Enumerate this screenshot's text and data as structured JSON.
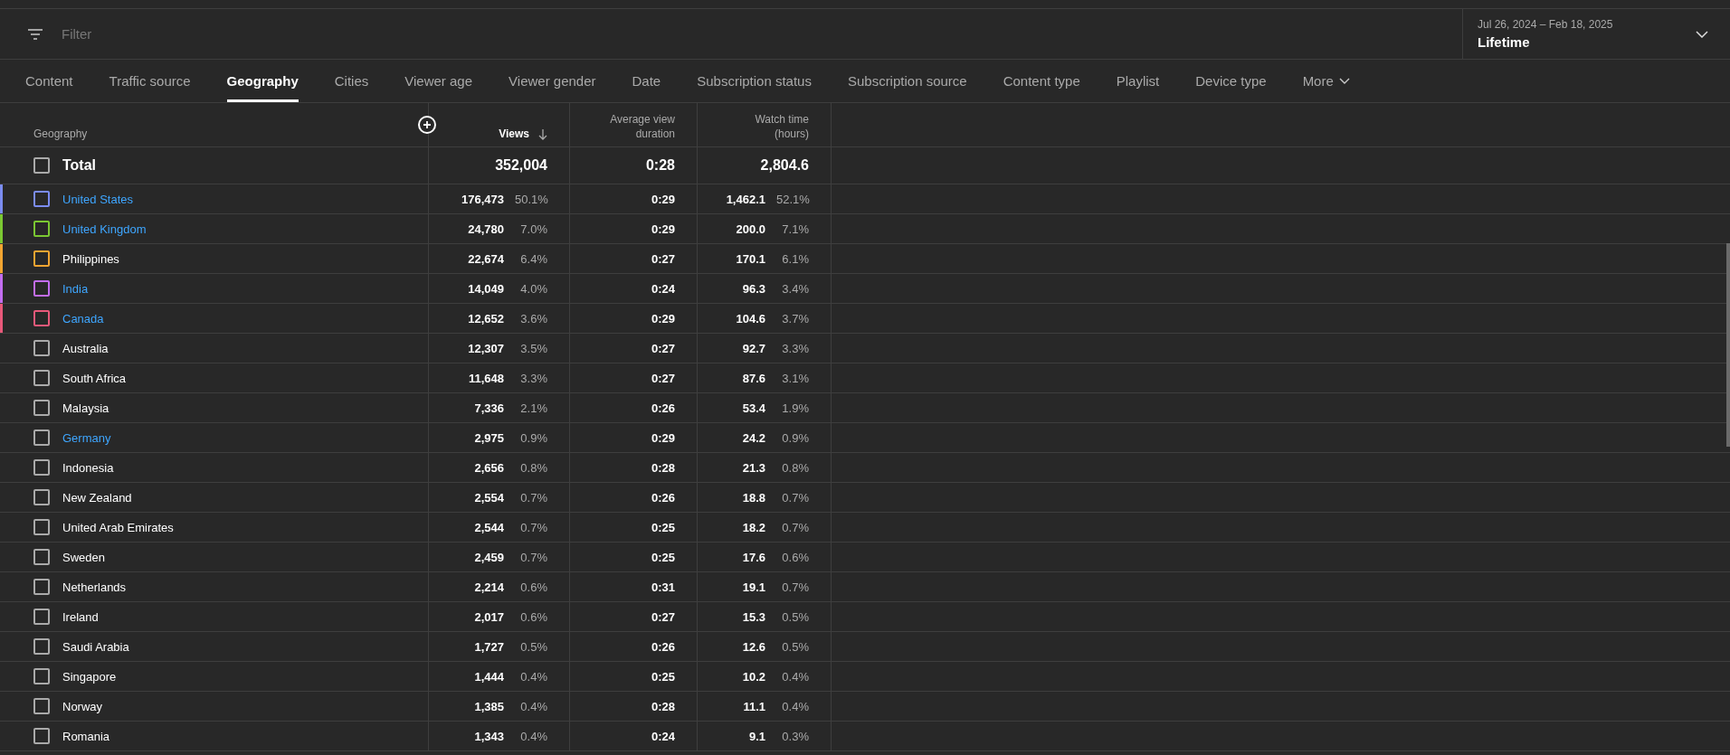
{
  "filter": {
    "placeholder": "Filter"
  },
  "date_range": {
    "range": "Jul 26, 2024 – Feb 18, 2025",
    "label": "Lifetime"
  },
  "tabs": [
    {
      "label": "Content",
      "selected": false
    },
    {
      "label": "Traffic source",
      "selected": false
    },
    {
      "label": "Geography",
      "selected": true
    },
    {
      "label": "Cities",
      "selected": false
    },
    {
      "label": "Viewer age",
      "selected": false
    },
    {
      "label": "Viewer gender",
      "selected": false
    },
    {
      "label": "Date",
      "selected": false
    },
    {
      "label": "Subscription status",
      "selected": false
    },
    {
      "label": "Subscription source",
      "selected": false
    },
    {
      "label": "Content type",
      "selected": false
    },
    {
      "label": "Playlist",
      "selected": false
    },
    {
      "label": "Device type",
      "selected": false
    },
    {
      "label": "More",
      "selected": false
    }
  ],
  "table": {
    "columns": [
      "Geography",
      "Views",
      "Average view duration",
      "Watch time (hours)"
    ],
    "total": {
      "label": "Total",
      "checked": false,
      "views": "352,004",
      "duration": "0:28",
      "watch_time": "2,804.6"
    },
    "rows": [
      {
        "name": "United States",
        "selected": true,
        "checked": false,
        "color": "#7b8cf0",
        "linked": true,
        "views": "176,473",
        "views_pct": "50.1%",
        "duration": "0:29",
        "watch_time": "1,462.1",
        "watch_pct": "52.1%"
      },
      {
        "name": "United Kingdom",
        "selected": true,
        "checked": false,
        "color": "#7bc832",
        "linked": true,
        "views": "24,780",
        "views_pct": "7.0%",
        "duration": "0:29",
        "watch_time": "200.0",
        "watch_pct": "7.1%"
      },
      {
        "name": "Philippines",
        "selected": true,
        "checked": false,
        "color": "#f2a531",
        "linked": false,
        "views": "22,674",
        "views_pct": "6.4%",
        "duration": "0:27",
        "watch_time": "170.1",
        "watch_pct": "6.1%"
      },
      {
        "name": "India",
        "selected": true,
        "checked": false,
        "color": "#c26df0",
        "linked": true,
        "views": "14,049",
        "views_pct": "4.0%",
        "duration": "0:24",
        "watch_time": "96.3",
        "watch_pct": "3.4%"
      },
      {
        "name": "Canada",
        "selected": true,
        "checked": false,
        "color": "#e8597a",
        "linked": true,
        "views": "12,652",
        "views_pct": "3.6%",
        "duration": "0:29",
        "watch_time": "104.6",
        "watch_pct": "3.7%"
      },
      {
        "name": "Australia",
        "selected": false,
        "checked": false,
        "linked": false,
        "views": "12,307",
        "views_pct": "3.5%",
        "duration": "0:27",
        "watch_time": "92.7",
        "watch_pct": "3.3%"
      },
      {
        "name": "South Africa",
        "selected": false,
        "checked": false,
        "linked": false,
        "views": "11,648",
        "views_pct": "3.3%",
        "duration": "0:27",
        "watch_time": "87.6",
        "watch_pct": "3.1%"
      },
      {
        "name": "Malaysia",
        "selected": false,
        "checked": false,
        "linked": false,
        "views": "7,336",
        "views_pct": "2.1%",
        "duration": "0:26",
        "watch_time": "53.4",
        "watch_pct": "1.9%"
      },
      {
        "name": "Germany",
        "selected": false,
        "checked": false,
        "linked": true,
        "views": "2,975",
        "views_pct": "0.9%",
        "duration": "0:29",
        "watch_time": "24.2",
        "watch_pct": "0.9%"
      },
      {
        "name": "Indonesia",
        "selected": false,
        "checked": false,
        "linked": false,
        "views": "2,656",
        "views_pct": "0.8%",
        "duration": "0:28",
        "watch_time": "21.3",
        "watch_pct": "0.8%"
      },
      {
        "name": "New Zealand",
        "selected": false,
        "checked": false,
        "linked": false,
        "views": "2,554",
        "views_pct": "0.7%",
        "duration": "0:26",
        "watch_time": "18.8",
        "watch_pct": "0.7%"
      },
      {
        "name": "United Arab Emirates",
        "selected": false,
        "checked": false,
        "linked": false,
        "views": "2,544",
        "views_pct": "0.7%",
        "duration": "0:25",
        "watch_time": "18.2",
        "watch_pct": "0.7%"
      },
      {
        "name": "Sweden",
        "selected": false,
        "checked": false,
        "linked": false,
        "views": "2,459",
        "views_pct": "0.7%",
        "duration": "0:25",
        "watch_time": "17.6",
        "watch_pct": "0.6%"
      },
      {
        "name": "Netherlands",
        "selected": false,
        "checked": false,
        "linked": false,
        "views": "2,214",
        "views_pct": "0.6%",
        "duration": "0:31",
        "watch_time": "19.1",
        "watch_pct": "0.7%"
      },
      {
        "name": "Ireland",
        "selected": false,
        "checked": false,
        "linked": false,
        "views": "2,017",
        "views_pct": "0.6%",
        "duration": "0:27",
        "watch_time": "15.3",
        "watch_pct": "0.5%"
      },
      {
        "name": "Saudi Arabia",
        "selected": false,
        "checked": false,
        "linked": false,
        "views": "1,727",
        "views_pct": "0.5%",
        "duration": "0:26",
        "watch_time": "12.6",
        "watch_pct": "0.5%"
      },
      {
        "name": "Singapore",
        "selected": false,
        "checked": false,
        "linked": false,
        "views": "1,444",
        "views_pct": "0.4%",
        "duration": "0:25",
        "watch_time": "10.2",
        "watch_pct": "0.4%"
      },
      {
        "name": "Norway",
        "selected": false,
        "checked": false,
        "linked": false,
        "views": "1,385",
        "views_pct": "0.4%",
        "duration": "0:28",
        "watch_time": "11.1",
        "watch_pct": "0.4%"
      },
      {
        "name": "Romania",
        "selected": false,
        "checked": false,
        "linked": false,
        "views": "1,343",
        "views_pct": "0.4%",
        "duration": "0:24",
        "watch_time": "9.1",
        "watch_pct": "0.3%"
      }
    ]
  }
}
